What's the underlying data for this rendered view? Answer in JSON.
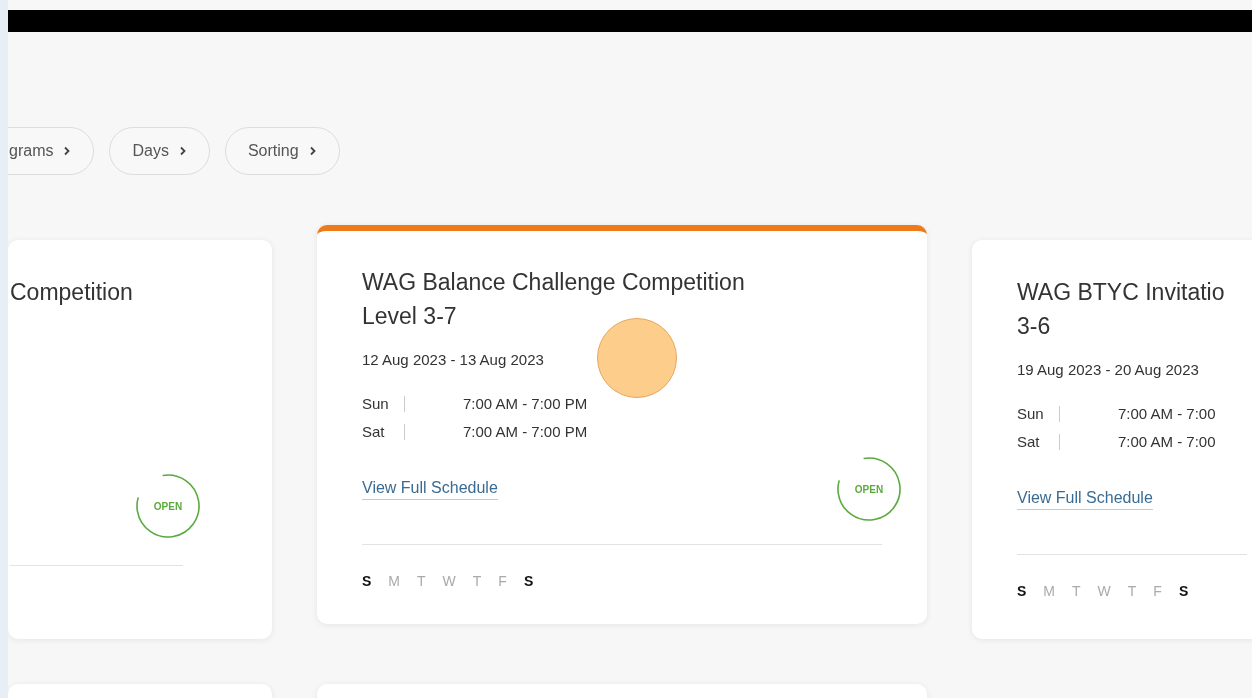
{
  "filters": [
    {
      "label": "grams"
    },
    {
      "label": "Days"
    },
    {
      "label": "Sorting"
    }
  ],
  "cards": [
    {
      "selected": false,
      "title": [
        "Competition"
      ],
      "status": {
        "label": "OPEN",
        "kind": "open"
      }
    },
    {
      "selected": true,
      "title": [
        "WAG Balance Challenge Competition",
        "Level 3-7"
      ],
      "dates": "12 Aug 2023 - 13 Aug 2023",
      "schedule": [
        {
          "day": "Sun",
          "time": "7:00 AM - 7:00 PM"
        },
        {
          "day": "Sat",
          "time": "7:00 AM - 7:00 PM"
        }
      ],
      "link": "View Full Schedule",
      "status": {
        "label": "OPEN",
        "kind": "open"
      },
      "days": [
        {
          "label": "S",
          "on": true
        },
        {
          "label": "M",
          "on": false
        },
        {
          "label": "T",
          "on": false
        },
        {
          "label": "W",
          "on": false
        },
        {
          "label": "T",
          "on": false
        },
        {
          "label": "F",
          "on": false
        },
        {
          "label": "S",
          "on": true
        }
      ]
    },
    {
      "selected": false,
      "title": [
        "WAG BTYC Invitatio",
        "3-6"
      ],
      "dates": "19 Aug 2023 - 20 Aug 2023",
      "schedule": [
        {
          "day": "Sun",
          "time": "7:00 AM - 7:00"
        },
        {
          "day": "Sat",
          "time": "7:00 AM - 7:00"
        }
      ],
      "link": "View Full Schedule",
      "days": [
        {
          "label": "S",
          "on": true
        },
        {
          "label": "M",
          "on": false
        },
        {
          "label": "T",
          "on": false
        },
        {
          "label": "W",
          "on": false
        },
        {
          "label": "T",
          "on": false
        },
        {
          "label": "F",
          "on": false
        },
        {
          "label": "S",
          "on": true
        }
      ]
    }
  ]
}
